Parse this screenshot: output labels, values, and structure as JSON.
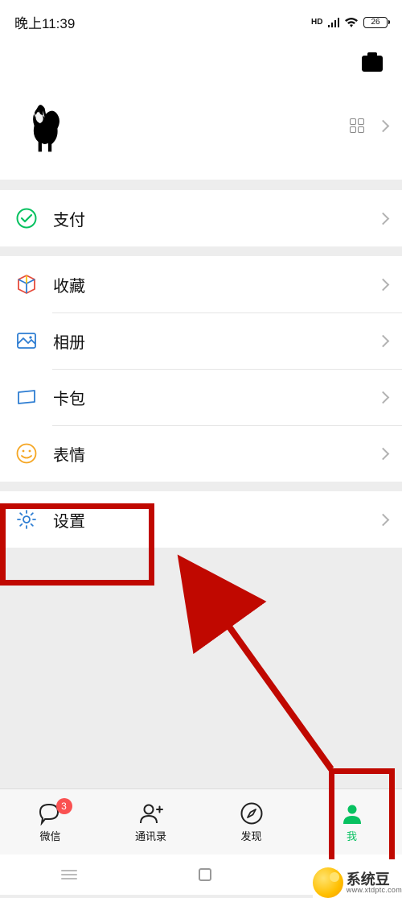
{
  "status": {
    "time": "晚上11:39",
    "battery": "26"
  },
  "menu": {
    "pay": "支付",
    "favorites": "收藏",
    "album": "相册",
    "cards": "卡包",
    "stickers": "表情",
    "settings": "设置"
  },
  "tabs": {
    "chats": {
      "label": "微信",
      "badge": "3"
    },
    "contacts": {
      "label": "通讯录"
    },
    "discover": {
      "label": "发现"
    },
    "me": {
      "label": "我"
    }
  },
  "watermark": {
    "cn": "系统豆",
    "en": "www.xtdptc.com"
  }
}
